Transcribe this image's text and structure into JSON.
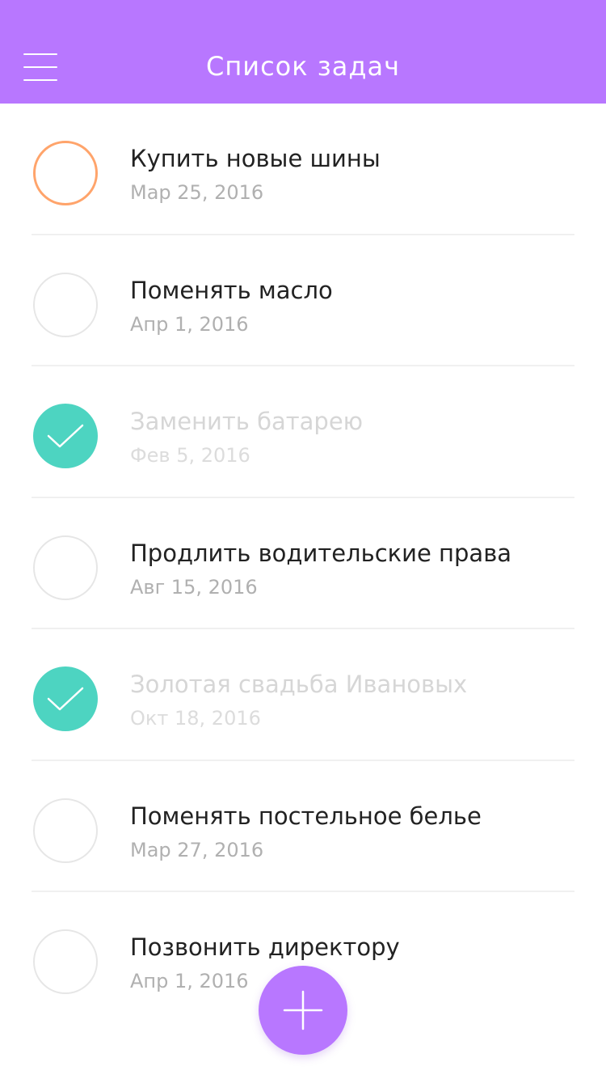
{
  "header": {
    "title": "Список задач",
    "menu_icon": "hamburger-menu-icon",
    "background": "#b877ff"
  },
  "tasks": [
    {
      "title": "Купить новые шины",
      "date": "Мар 25, 2016",
      "state": "pending"
    },
    {
      "title": "Поменять масло",
      "date": "Апр 1, 2016",
      "state": "open"
    },
    {
      "title": "Заменить батарею",
      "date": "Фев 5, 2016",
      "state": "done"
    },
    {
      "title": "Продлить водительские права",
      "date": "Авг 15, 2016",
      "state": "open"
    },
    {
      "title": "Золотая свадьба Ивановых",
      "date": "Окт 18, 2016",
      "state": "done"
    },
    {
      "title": "Поменять постельное белье",
      "date": "Мар 27, 2016",
      "state": "open"
    },
    {
      "title": "Позвонить директору",
      "date": "Апр 1, 2016",
      "state": "open"
    }
  ],
  "fab": {
    "icon": "plus-icon",
    "background": "#b877ff"
  },
  "colors": {
    "accent": "#b877ff",
    "done": "#4dd4c1",
    "pending": "#ffa46b"
  }
}
